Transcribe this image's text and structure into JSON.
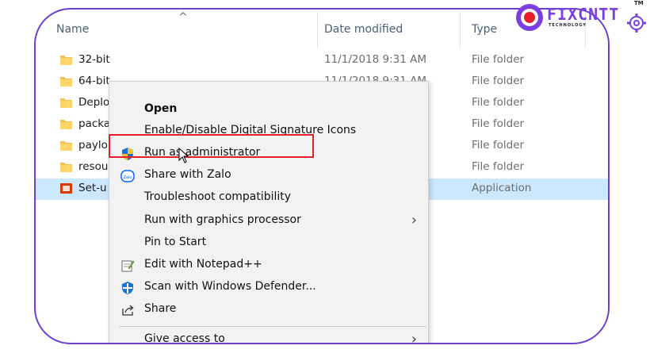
{
  "explorer": {
    "columns": {
      "name": "Name",
      "sort_arrow": "^",
      "date": "Date modified",
      "type": "Type"
    },
    "rows": [
      {
        "name": "32-bit",
        "date": "11/1/2018 9:31 AM",
        "type": "File folder",
        "icon": "folder-icon"
      },
      {
        "name": "64-bit",
        "date": "11/1/2018 9:31 AM",
        "type": "File folder",
        "icon": "folder-icon"
      },
      {
        "name": "Deplo",
        "date": "",
        "type": "File folder",
        "icon": "folder-icon"
      },
      {
        "name": "packa",
        "date": "",
        "type": "File folder",
        "icon": "folder-icon"
      },
      {
        "name": "paylo",
        "date": "",
        "type": "File folder",
        "icon": "folder-icon"
      },
      {
        "name": "resou",
        "date": "",
        "type": "File folder",
        "icon": "folder-icon"
      },
      {
        "name": "Set-u",
        "date": "",
        "type": "Application",
        "icon": "office-setup-icon",
        "selected": true
      }
    ]
  },
  "context_menu": {
    "items": [
      {
        "label": "Open",
        "bold": true
      },
      {
        "label": "Enable/Disable Digital Signature Icons"
      },
      {
        "label": "Run as administrator",
        "icon": "uac-shield-icon",
        "highlighted": true
      },
      {
        "label": "Share with Zalo",
        "icon": "zalo-icon"
      },
      {
        "label": "Troubleshoot compatibility"
      },
      {
        "label": "Run with graphics processor",
        "submenu": true
      },
      {
        "label": "Pin to Start"
      },
      {
        "label": "Edit with Notepad++",
        "icon": "notepadpp-icon"
      },
      {
        "label": "Scan with Windows Defender...",
        "icon": "defender-icon"
      },
      {
        "label": "Share",
        "icon": "share-icon"
      },
      {
        "label": "Give access to",
        "submenu": true
      }
    ],
    "submenu_glyph": "›"
  },
  "watermark": {
    "text": "FIXCNTT",
    "sub": "TECHNOLOGY",
    "tm": "TM"
  },
  "colors": {
    "frame_border": "#6b3fd0",
    "highlight_box": "#e5202a",
    "selection": "#cce8ff",
    "folder": "#f2c04d"
  }
}
